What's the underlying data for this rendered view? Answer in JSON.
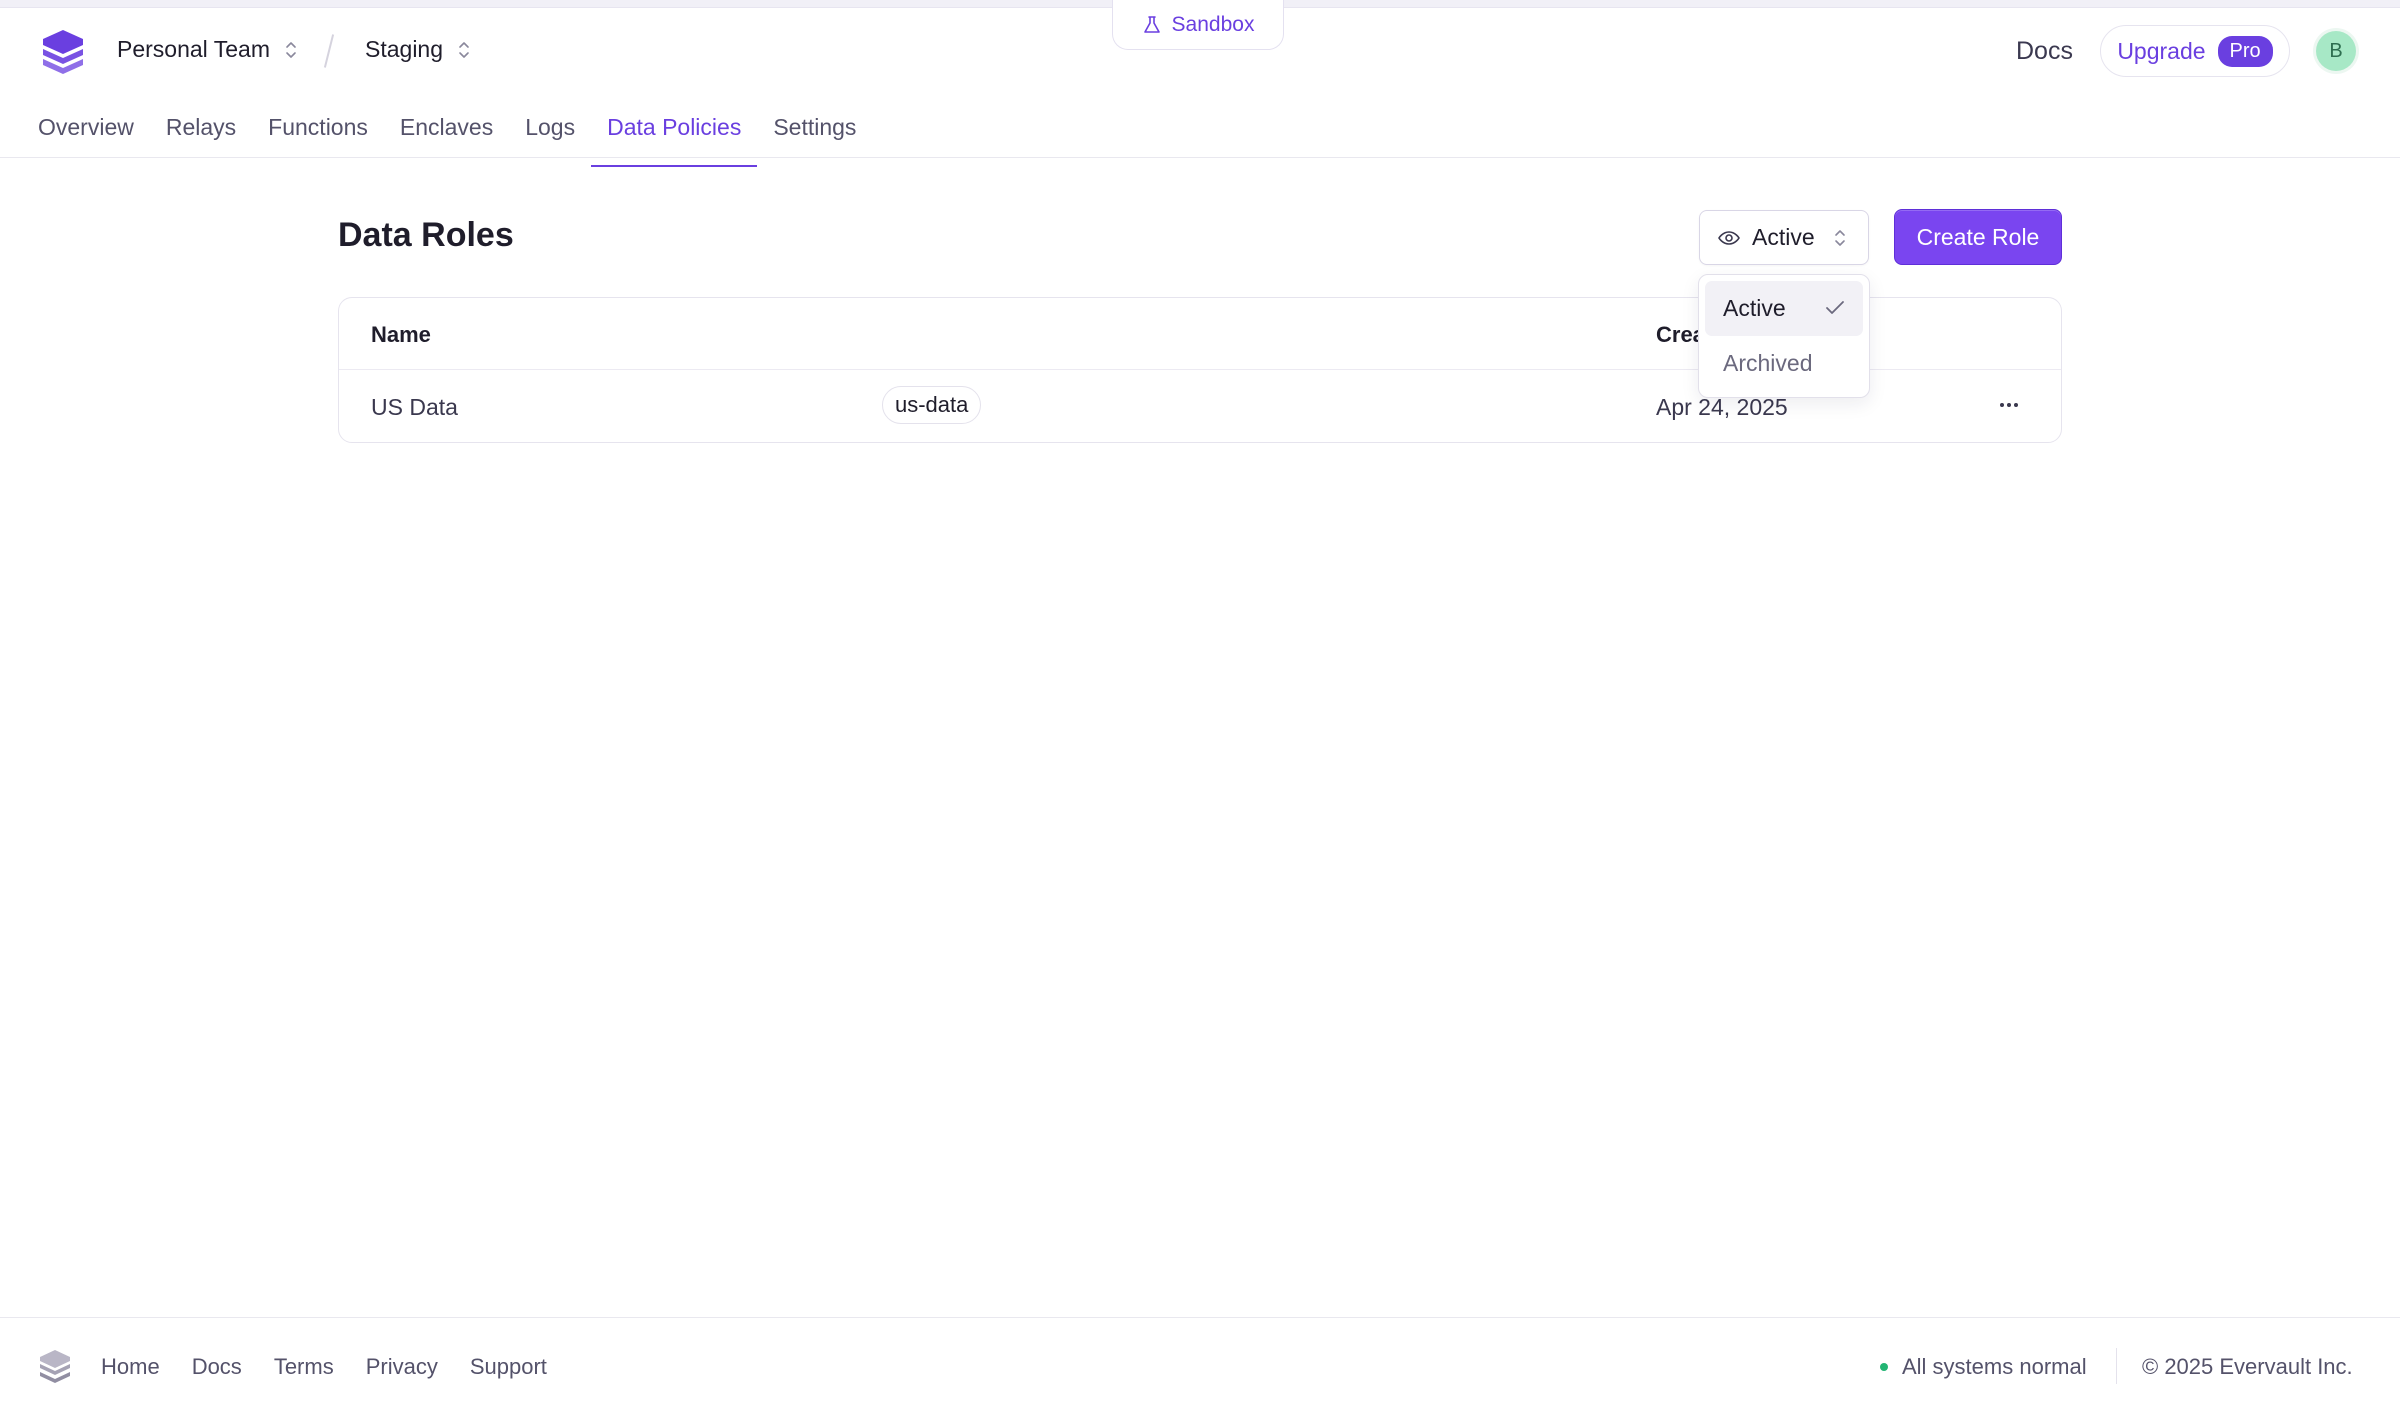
{
  "environment_badge": "Sandbox",
  "header": {
    "team": "Personal Team",
    "environment": "Staging",
    "docs": "Docs",
    "upgrade": "Upgrade",
    "pro_badge": "Pro",
    "avatar_initial": "B"
  },
  "tabs": [
    {
      "label": "Overview",
      "active": false
    },
    {
      "label": "Relays",
      "active": false
    },
    {
      "label": "Functions",
      "active": false
    },
    {
      "label": "Enclaves",
      "active": false
    },
    {
      "label": "Logs",
      "active": false
    },
    {
      "label": "Data Policies",
      "active": true
    },
    {
      "label": "Settings",
      "active": false
    }
  ],
  "main": {
    "title": "Data Roles",
    "filter_value": "Active",
    "create_button": "Create Role"
  },
  "table": {
    "columns": {
      "name": "Name",
      "created": "Crea"
    },
    "rows": [
      {
        "name": "US Data",
        "slug": "us-data",
        "created": "Apr 24, 2025"
      }
    ]
  },
  "dropdown": {
    "options": [
      {
        "label": "Active",
        "selected": true
      },
      {
        "label": "Archived",
        "selected": false
      }
    ]
  },
  "footer": {
    "links": [
      "Home",
      "Docs",
      "Terms",
      "Privacy",
      "Support"
    ],
    "status": "All systems normal",
    "copyright": "© 2025 Evervault Inc."
  },
  "colors": {
    "accent": "#6a3fe0",
    "button": "#7a45f0",
    "status_ok": "#22b573"
  }
}
